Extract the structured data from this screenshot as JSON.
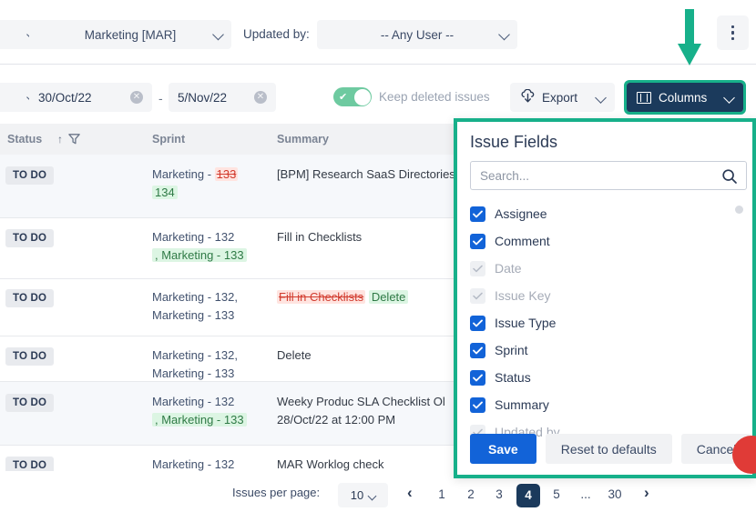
{
  "toolbar": {
    "project_select": "Marketing [MAR]",
    "updated_by_label": "Updated by:",
    "user_select": "-- Any User --",
    "kebab_icon": "more-vertical-icon",
    "date_from": "30/Oct/22",
    "date_to": "5/Nov/22",
    "date_separator": "-",
    "toggle_label": "Keep deleted issues",
    "toggle_on": true,
    "export_label": "Export",
    "export_icon": "cloud-download-icon",
    "columns_label": "Columns",
    "columns_icon": "columns-icon",
    "highlight_color": "#17b08a",
    "columns_bg": "#1b3a5c"
  },
  "table": {
    "headers": {
      "status": "Status",
      "sort_icon": "sort-ascending-icon",
      "filter_icon": "filter-icon",
      "sprint": "Sprint",
      "summary": "Summary"
    },
    "rows": [
      {
        "status": "TO DO",
        "sprint_plain": "Marketing - ",
        "sprint_removed": "133",
        "sprint_added": "134",
        "summary": "[BPM] Research SaaS Directories"
      },
      {
        "status": "TO DO",
        "sprint_plain": "Marketing - 132",
        "sprint_added": ", Marketing - 133",
        "summary": "Fill in Checklists"
      },
      {
        "status": "TO DO",
        "sprint_plain": "Marketing - 132, Marketing - 133",
        "summary_removed": "Fill in Checklists",
        "summary_added": "Delete"
      },
      {
        "status": "TO DO",
        "sprint_plain": "Marketing - 132, Marketing - 133",
        "summary": "Delete"
      },
      {
        "status": "TO DO",
        "sprint_plain": "Marketing - 132",
        "sprint_added": ", Marketing - 133",
        "summary": "Weeky Produc SLA Checklist Ol 28/Oct/22 at 12:00 PM"
      },
      {
        "status": "TO DO",
        "sprint_plain": "Marketing - 132",
        "summary": "MAR Worklog check"
      }
    ]
  },
  "pagination": {
    "per_page_label": "Issues per page:",
    "per_page_value": "10",
    "prev_icon": "chevron-left-icon",
    "next_icon": "chevron-right-icon",
    "pages": [
      "1",
      "2",
      "3",
      "4",
      "5",
      "...",
      "30"
    ],
    "active_page": "4"
  },
  "panel": {
    "title": "Issue Fields",
    "search_placeholder": "Search...",
    "search_value": "",
    "search_icon": "search-icon",
    "fields": [
      {
        "label": "Assignee",
        "checked": true,
        "disabled": false
      },
      {
        "label": "Comment",
        "checked": true,
        "disabled": false
      },
      {
        "label": "Date",
        "checked": true,
        "disabled": true
      },
      {
        "label": "Issue Key",
        "checked": true,
        "disabled": true
      },
      {
        "label": "Issue Type",
        "checked": true,
        "disabled": false
      },
      {
        "label": "Sprint",
        "checked": true,
        "disabled": false
      },
      {
        "label": "Status",
        "checked": true,
        "disabled": false
      },
      {
        "label": "Summary",
        "checked": true,
        "disabled": false
      },
      {
        "label": "Updated by",
        "checked": true,
        "disabled": true
      }
    ],
    "save_label": "Save",
    "reset_label": "Reset to defaults",
    "cancel_label": "Cancel",
    "save_color": "#1263d8"
  }
}
